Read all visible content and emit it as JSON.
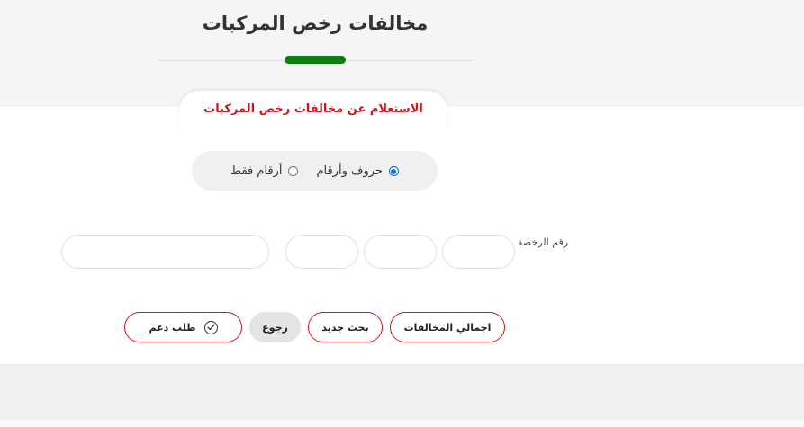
{
  "page": {
    "title": "مخالفات رخص المركبات"
  },
  "section": {
    "tab_label": "الاستعلام عن مخالفات رخص المركبات"
  },
  "plate_type": {
    "options": [
      {
        "label": "حروف وأرقام",
        "checked": true
      },
      {
        "label": "أرقام فقط",
        "checked": false
      }
    ]
  },
  "form": {
    "license_label": "رقم الرخصة",
    "plate_inputs": [
      {
        "value": "",
        "placeholder": ""
      },
      {
        "value": "",
        "placeholder": ""
      },
      {
        "value": "",
        "placeholder": ""
      },
      {
        "value": "",
        "placeholder": ""
      }
    ]
  },
  "actions": {
    "total_violations": "اجمالي المخالفات",
    "new_search": "بحث جديد",
    "back": "رجوع",
    "support_request": "طلب دعم"
  },
  "icons": {
    "support": "check-circle-icon"
  },
  "colors": {
    "accent_green": "#0c7d12",
    "accent_red": "#d4141c",
    "radio_blue": "#0b69d9"
  }
}
